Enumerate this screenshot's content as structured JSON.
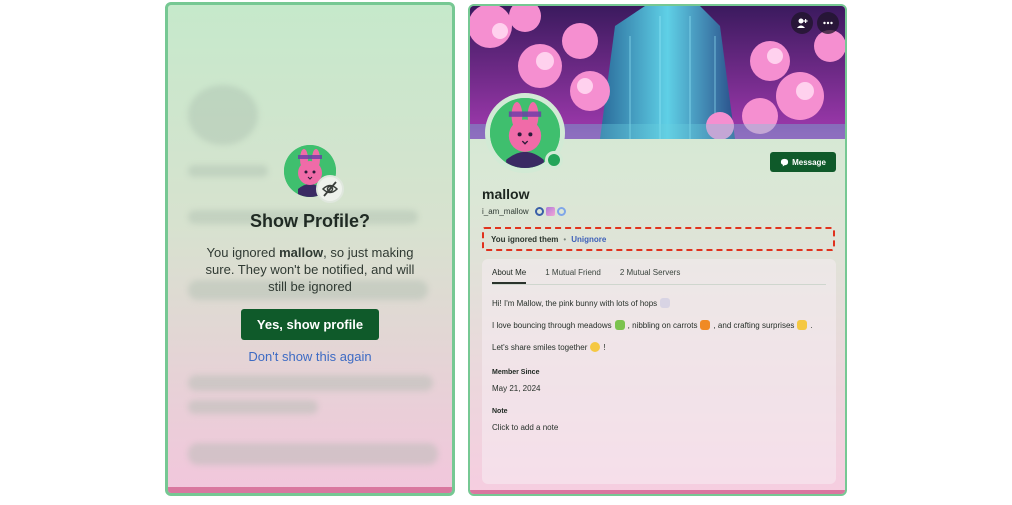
{
  "left_dialog": {
    "title": "Show Profile?",
    "body_prefix": "You ignored ",
    "body_name": "mallow",
    "body_suffix": ", so just making sure. They won't be notified, and will still be ignored",
    "confirm_label": "Yes, show profile",
    "dismiss_label": "Don't show this again"
  },
  "profile": {
    "display_name": "mallow",
    "username": "i_am_mallow",
    "message_label": "Message",
    "ignored_text": "You ignored them",
    "separator": "•",
    "unignore_label": "Unignore",
    "tabs": [
      "About Me",
      "1 Mutual Friend",
      "2 Mutual Servers"
    ],
    "bio": {
      "line1": "Hi! I'm Mallow, the pink bunny with lots of hops",
      "line2_a": "I love bouncing through meadows",
      "line2_b": ", nibbling on carrots",
      "line2_c": ", and crafting surprises",
      "line2_d": ".",
      "line3_a": "Let's share smiles together",
      "line3_b": "!"
    },
    "member_since_label": "Member Since",
    "member_since_value": "May 21, 2024",
    "note_label": "Note",
    "note_placeholder": "Click to add a note"
  },
  "colors": {
    "primary_green": "#0f5a2a",
    "link_blue": "#3d6bc4",
    "highlight_red": "#e0321e",
    "online_green": "#23a559",
    "border_green": "#76c893"
  },
  "icons": {
    "hidden_eye": "eye-slash-icon",
    "add_friend": "add-friend-icon",
    "more": "more-icon",
    "message": "chat-bubble-icon"
  }
}
